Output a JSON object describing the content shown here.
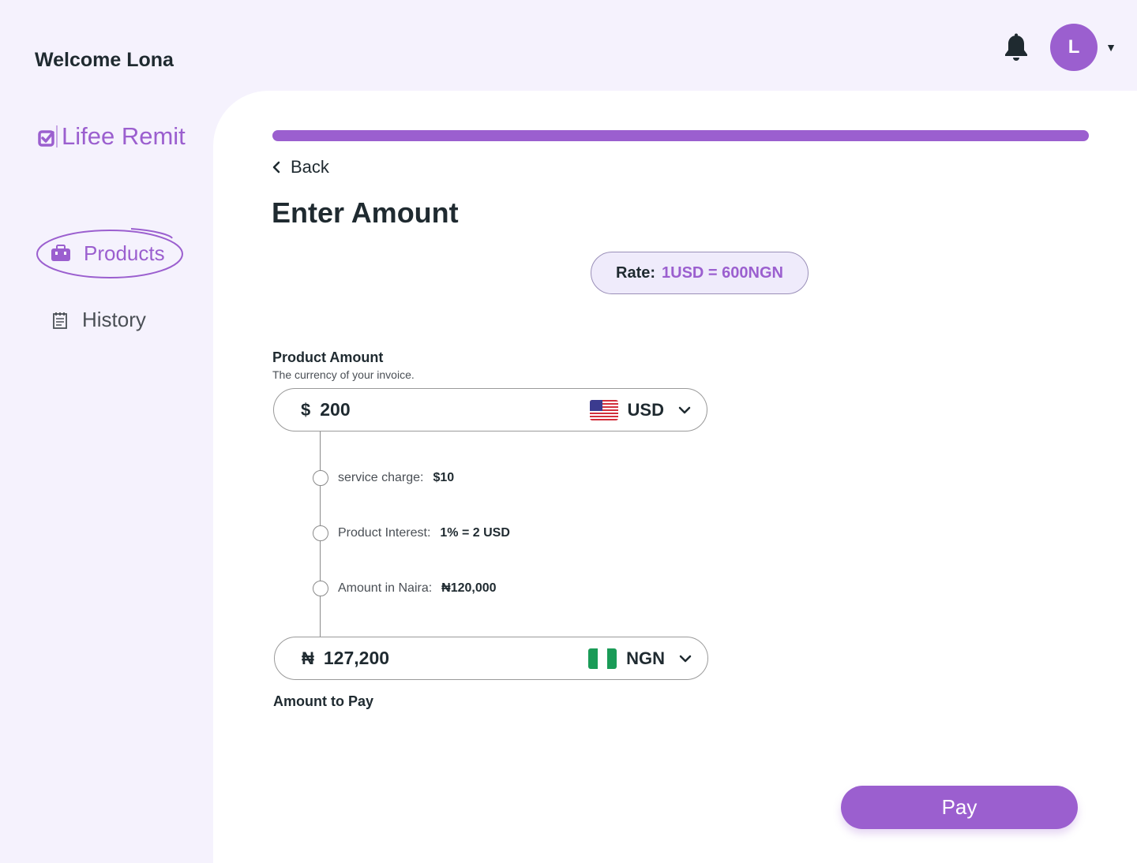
{
  "header": {
    "welcome": "Welcome Lona",
    "avatar_initial": "L",
    "icons": [
      "bell-icon",
      "chevron-down-icon"
    ]
  },
  "sidebar": {
    "logo_text": "Lifee Remit",
    "items": [
      {
        "label": "Products",
        "icon": "briefcase-icon",
        "active": true
      },
      {
        "label": "History",
        "icon": "notepad-icon",
        "active": false
      }
    ]
  },
  "main": {
    "progress": 1.0,
    "back_label": "Back",
    "title": "Enter Amount",
    "rate": {
      "label": "Rate:",
      "value": "1USD = 600NGN"
    },
    "product_amount": {
      "label": "Product Amount",
      "sublabel": "The currency of your invoice.",
      "symbol": "$",
      "value": "200",
      "currency": "USD"
    },
    "breakdown": [
      {
        "label": "service charge:",
        "value": "$10"
      },
      {
        "label": "Product Interest:",
        "value": "1% = 2 USD"
      },
      {
        "label": "Amount in Naira:",
        "value": "₦120,000"
      }
    ],
    "amount_to_pay": {
      "symbol": "₦",
      "value": "127,200",
      "currency": "NGN",
      "label": "Amount to Pay"
    },
    "pay_button": "Pay"
  },
  "colors": {
    "accent": "#9b5fcf",
    "background": "#f5f2fd",
    "text": "#1f2a30",
    "ngn_green": "#1a9b57"
  }
}
